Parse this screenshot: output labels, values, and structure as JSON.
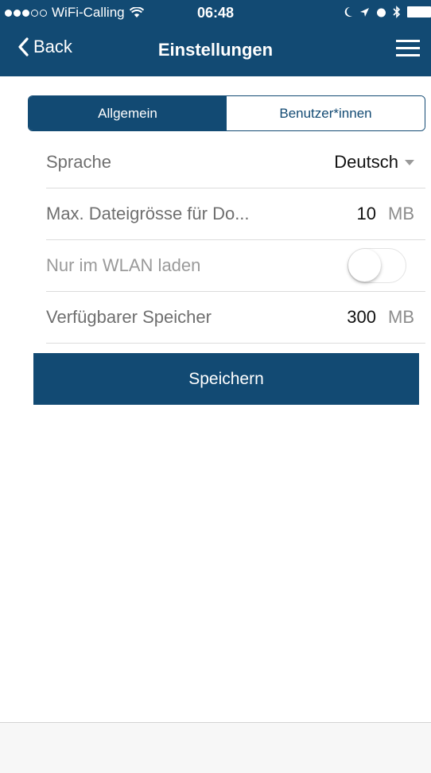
{
  "status_bar": {
    "carrier": "WiFi-Calling",
    "time": "06:48"
  },
  "nav": {
    "back_label": "Back",
    "title": "Einstellungen"
  },
  "tabs": [
    {
      "label": "Allgemein",
      "active": true
    },
    {
      "label": "Benutzer*innen",
      "active": false
    }
  ],
  "settings": {
    "language": {
      "label": "Sprache",
      "value": "Deutsch"
    },
    "max_file_size": {
      "label": "Max. Dateigrösse für Do...",
      "value": "10",
      "unit": "MB"
    },
    "wlan_only": {
      "label": "Nur im WLAN laden",
      "on": false
    },
    "storage": {
      "label": "Verfügbarer Speicher",
      "value": "300",
      "unit": "MB"
    }
  },
  "save_label": "Speichern",
  "colors": {
    "primary": "#124a73",
    "background": "#ffffff"
  }
}
